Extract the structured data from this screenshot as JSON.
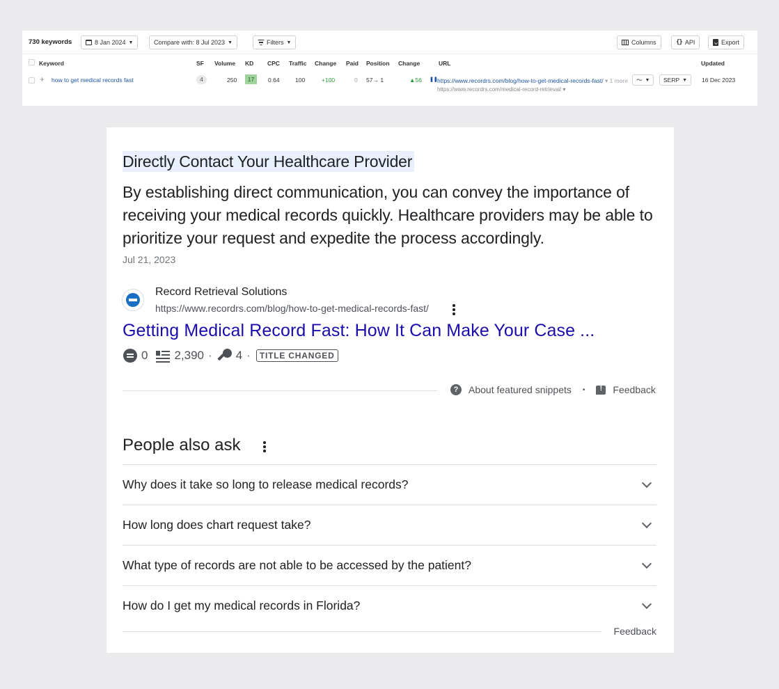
{
  "toolbar": {
    "keyword_count": "730 keywords",
    "date": "8 Jan 2024",
    "compare": "Compare with: 8 Jul 2023",
    "filters": "Filters",
    "columns": "Columns",
    "api": "API",
    "export": "Export"
  },
  "table": {
    "headers": {
      "keyword": "Keyword",
      "sf": "SF",
      "volume": "Volume",
      "kd": "KD",
      "cpc": "CPC",
      "traffic": "Traffic",
      "change": "Change",
      "paid": "Paid",
      "position": "Position",
      "pos_change": "Change",
      "url": "URL",
      "updated": "Updated"
    },
    "row": {
      "keyword": "how to get medical records fast",
      "sf": "4",
      "volume": "250",
      "kd": "17",
      "cpc": "0.64",
      "traffic": "100",
      "change": "+100",
      "paid": "0",
      "position": "57→ 1",
      "pos_change": "▲56",
      "url_main": "https://www.recordrs.com/blog/how-to-get-medical-records-fast/",
      "url_more": "1 more",
      "url_alt": "https://www.recordrs.com/medical-record-retrieval/",
      "serp": "SERP",
      "updated": "16 Dec 2023"
    }
  },
  "snippet": {
    "heading": "Directly Contact Your Healthcare Provider",
    "text": "By establishing direct communication, you can convey the importance of receiving your medical records quickly. Healthcare providers may be able to prioritize your request and expedite the process accordingly.",
    "date": "Jul 21, 2023",
    "site_name": "Record Retrieval Solutions",
    "site_url": "https://www.recordrs.com/blog/how-to-get-medical-records-fast/",
    "result_title": "Getting Medical Record Fast: How It Can Make Your Case ...",
    "comments": "0",
    "words": "2,390",
    "keywords": "4",
    "badge": "TITLE CHANGED",
    "about": "About featured snippets",
    "feedback": "Feedback"
  },
  "paa": {
    "title": "People also ask",
    "questions": [
      "Why does it take so long to release medical records?",
      "How long does chart request take?",
      "What type of records are not able to be accessed by the patient?",
      "How do I get my medical records in Florida?"
    ],
    "feedback": "Feedback"
  }
}
